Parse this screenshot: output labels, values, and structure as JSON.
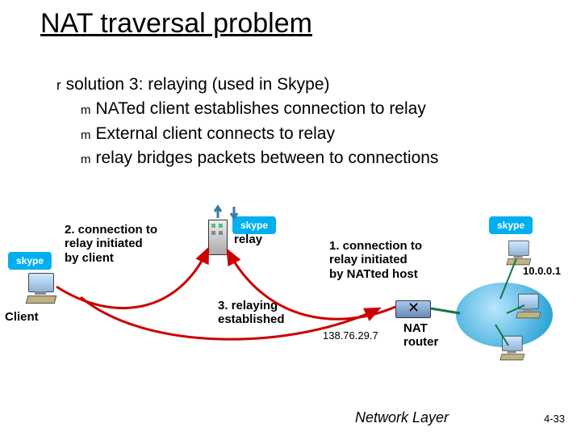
{
  "title": "NAT traversal problem",
  "bullet_main": "solution 3: relaying (used in Skype)",
  "bullet_sub1": "NATed client establishes connection to relay",
  "bullet_sub2": "External client connects to relay",
  "bullet_sub3": "relay bridges packets between to connections",
  "label_client": "Client",
  "label_relay": "relay",
  "label_conn2_l1": "2. connection to",
  "label_conn2_l2": "relay initiated",
  "label_conn2_l3": "by client",
  "label_conn3_l1": "3. relaying",
  "label_conn3_l2": "established",
  "label_conn1_l1": "1. connection to",
  "label_conn1_l2": "relay initiated",
  "label_conn1_l3": "by NATted host",
  "label_nat_l1": "NAT",
  "label_nat_l2": "router",
  "ip_public": "138.76.29.7",
  "ip_private": "10.0.0.1",
  "skype_text": "skype",
  "footer_section": "Network Layer",
  "footer_page": "4-33"
}
